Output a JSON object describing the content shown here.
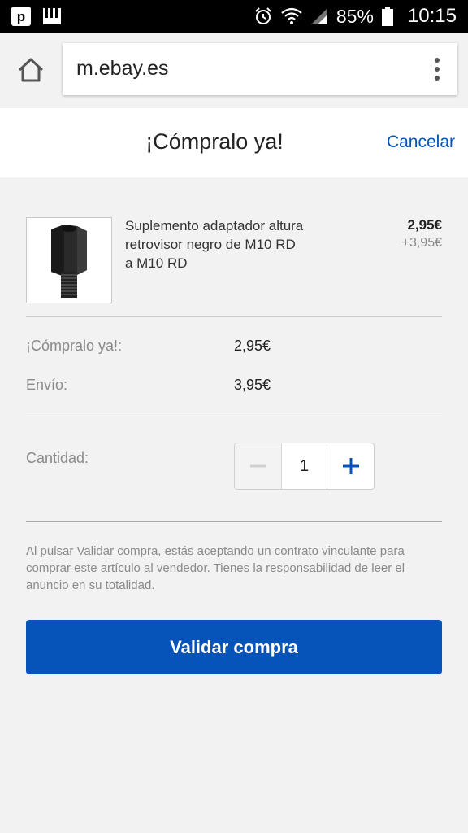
{
  "status_bar": {
    "battery": "85%",
    "time": "10:15"
  },
  "browser": {
    "url": "m.ebay.es"
  },
  "header": {
    "title": "¡Cómpralo ya!",
    "cancel_label": "Cancelar"
  },
  "item": {
    "title": "Suplemento adaptador altura retrovisor negro de M10 RD a M10 RD",
    "price": "2,95€",
    "shipping": "+3,95€"
  },
  "summary": {
    "buy_now_label": "¡Cómpralo ya!:",
    "buy_now_value": "2,95€",
    "shipping_label": "Envío:",
    "shipping_value": "3,95€"
  },
  "quantity": {
    "label": "Cantidad:",
    "value": "1",
    "minus_symbol": "−",
    "plus_symbol": "+"
  },
  "legal_text": "Al pulsar Validar compra, estás aceptando un contrato vinculante para comprar este artículo al vendedor. Tienes la responsabilidad de leer el anuncio en su totalidad.",
  "validate_button": "Validar compra",
  "colors": {
    "accent": "#0654ba",
    "muted_text": "#8a8a8a"
  }
}
